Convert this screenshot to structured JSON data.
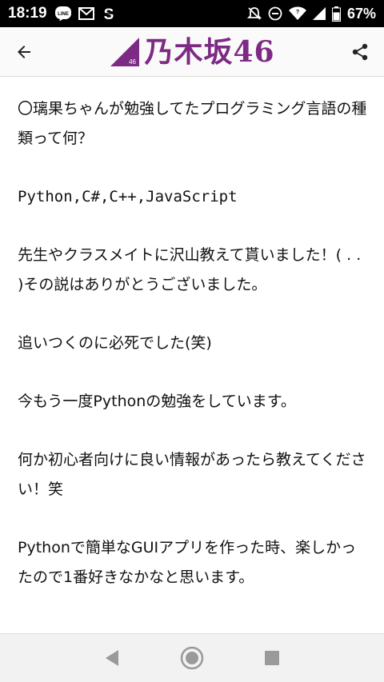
{
  "status_bar": {
    "time": "18:19",
    "battery": "67%",
    "icons_left": [
      "line-icon",
      "gmail-icon",
      "s-app-icon"
    ],
    "icons_right": [
      "mute-icon",
      "dnd-icon",
      "wifi-icon",
      "signal-icon",
      "battery-icon"
    ]
  },
  "header": {
    "logo_text": "乃木坂46",
    "logo_mark_text": "46",
    "brand_color": "#7d2a84"
  },
  "content": {
    "paragraphs": [
      "〇璃果ちゃんが勉強してたプログラミング言語の種類って何？",
      "Python,C#,C++,JavaScript",
      "先生やクラスメイトに沢山教えて貰いました！( . . )その説はありがとうございました。",
      "追いつくのに必死でした(笑)",
      "今もう一度Pythonの勉強をしています。",
      "何か初心者向けに良い情報があったら教えてください！笑",
      "Pythonで簡単なGUIアプリを作った時、楽しかったので1番好きなかなと思います。"
    ]
  }
}
